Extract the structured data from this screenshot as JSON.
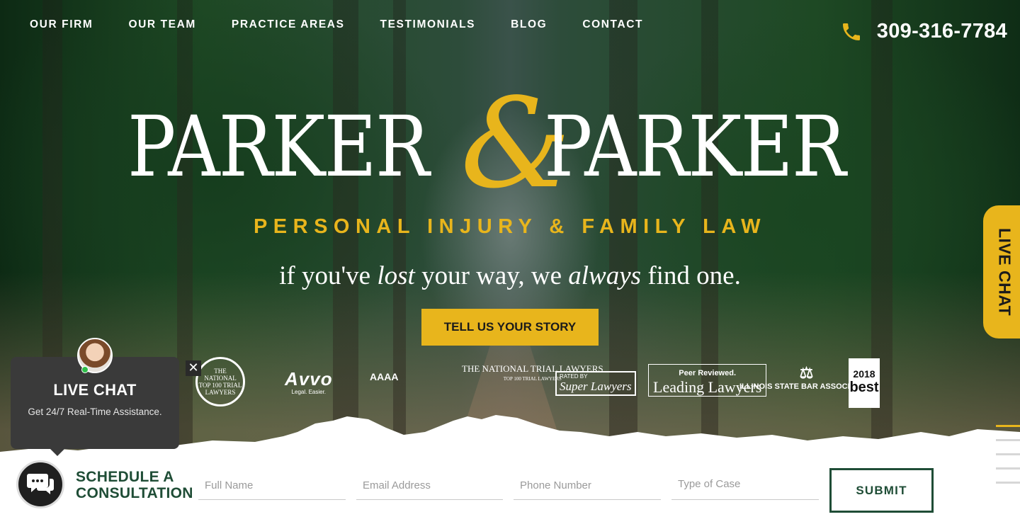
{
  "nav": {
    "items": [
      {
        "label": "OUR FIRM"
      },
      {
        "label": "OUR TEAM"
      },
      {
        "label": "PRACTICE AREAS"
      },
      {
        "label": "TESTIMONIALS"
      },
      {
        "label": "BLOG"
      },
      {
        "label": "CONTACT"
      }
    ],
    "phone_icon": "phone-icon",
    "phone": "309-316-7784"
  },
  "hero": {
    "logo_left": "PARKER",
    "logo_amp": "&",
    "logo_right": "PARKER",
    "tagline": "PERSONAL INJURY & FAMILY LAW",
    "slogan": {
      "p1": "if you've ",
      "em1": "lost",
      "p2": " your way, we ",
      "em2": "always",
      "p3": " find one."
    },
    "cta": "TELL US YOUR STORY"
  },
  "badges": {
    "national": "THE NATIONAL TOP 100 TRIAL LAWYERS",
    "avvo": "Avvo",
    "avvo_sub": "Legal. Easier.",
    "aaaa": "AAAA",
    "ntl": "THE NATIONAL TRIAL LAWYERS",
    "ntl_sub": "TOP 100 TRIAL LAWYERS",
    "super_pre": "RATED BY",
    "super": "Super Lawyers",
    "leading_pre": "Peer Reviewed.",
    "leading": "Leading Lawyers",
    "isba": "ILLINOIS STATE BAR ASSOCIATION",
    "best_year": "2018",
    "best": "best"
  },
  "live_tab": "LIVE CHAT",
  "chat": {
    "title": "LIVE CHAT",
    "subtitle": "Get 24/7 Real-Time Assistance.",
    "close": "✕",
    "icon": "chat-bubble-icon"
  },
  "form": {
    "title_line1": "SCHEDULE A",
    "title_line2": "CONSULTATION",
    "full_name": "Full Name",
    "email": "Email Address",
    "phone": "Phone Number",
    "case_type": "Type of Case",
    "submit": "SUBMIT"
  },
  "colors": {
    "accent": "#e8b51c",
    "brand_green": "#1f4d36",
    "chat_bg": "#3a3a3a"
  }
}
